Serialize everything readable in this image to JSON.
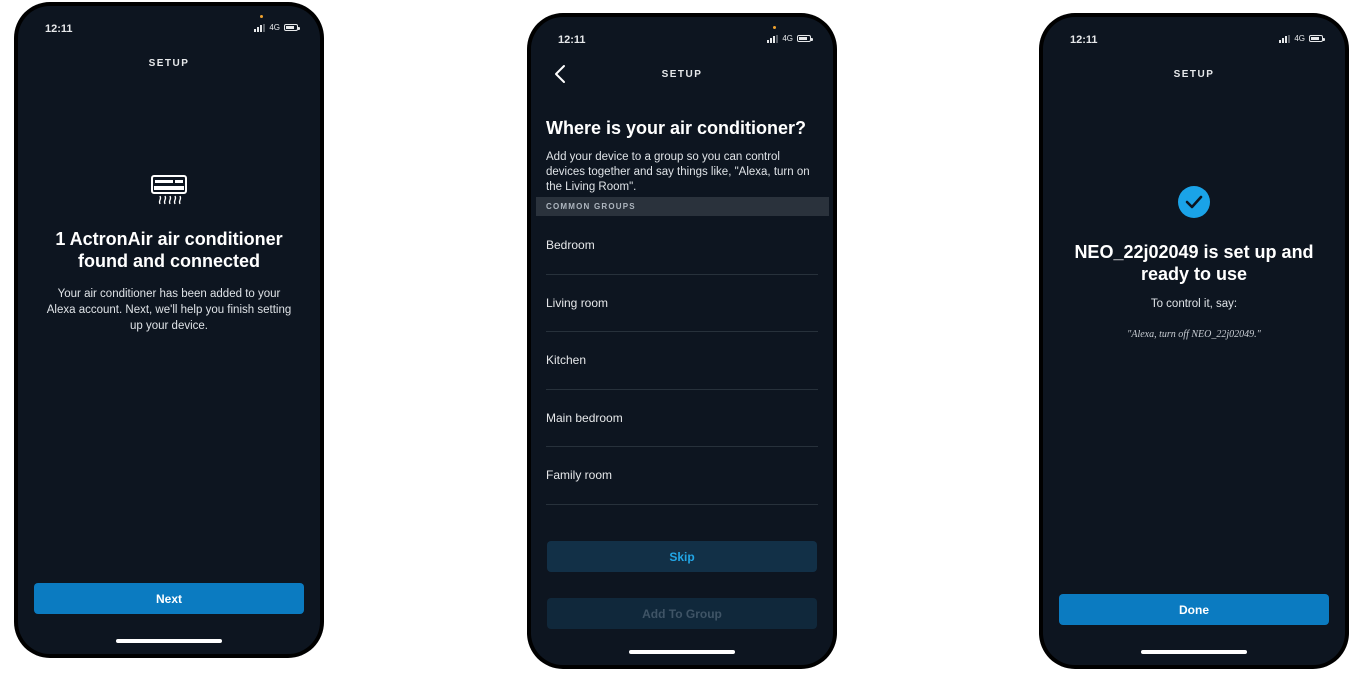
{
  "screens": [
    {
      "status": {
        "time": "12:11",
        "network": "4G"
      },
      "title": "SETUP",
      "device_icon": "air-conditioner-icon",
      "heading": "1 ActronAir air conditioner found and connected",
      "body": "Your air conditioner has been added to your Alexa account. Next, we'll help you finish setting up your device.",
      "next_label": "Next"
    },
    {
      "status": {
        "time": "12:11",
        "network": "4G"
      },
      "title": "SETUP",
      "back_icon": "chevron-left-icon",
      "heading": "Where is your air conditioner?",
      "description": "Add your device to a group so you can control devices together and say things like, \"Alexa, turn on the Living Room\".",
      "groups_header": "COMMON GROUPS",
      "groups": [
        "Bedroom",
        "Living room",
        "Kitchen",
        "Main bedroom",
        "Family room"
      ],
      "skip_label": "Skip",
      "add_label": "Add To Group"
    },
    {
      "status": {
        "time": "12:11",
        "network": "4G"
      },
      "title": "SETUP",
      "success_icon": "checkmark-icon",
      "heading": "NEO_22j02049 is set up and ready to use",
      "control_text": "To control it, say:",
      "example_phrase": "\"Alexa, turn off NEO_22j02049.\"",
      "done_label": "Done"
    }
  ],
  "colors": {
    "background": "#0d1520",
    "primary_button": "#0b7bc1",
    "secondary_button": "#123047",
    "accent": "#1aa3e8"
  }
}
